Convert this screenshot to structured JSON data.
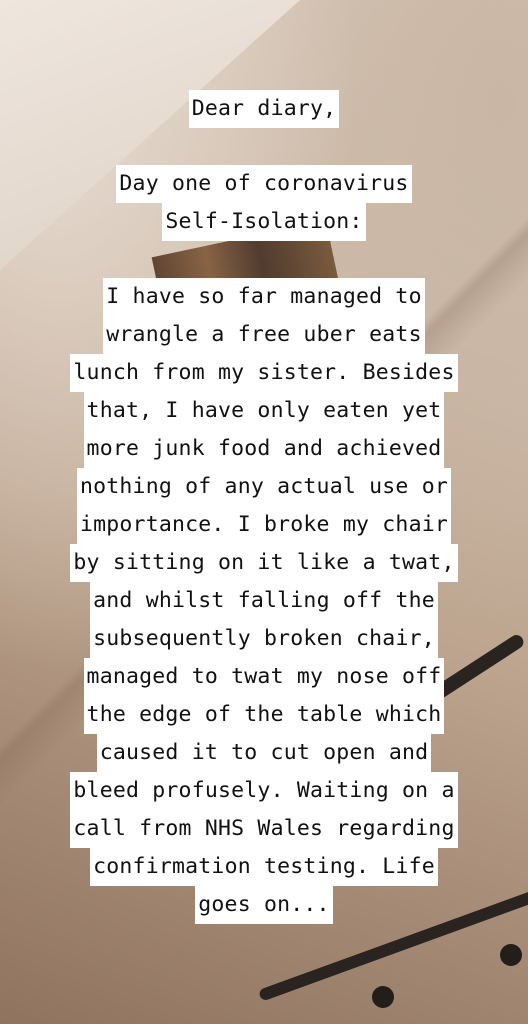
{
  "greeting": "Dear diary,",
  "heading_lines": [
    "Day one of coronavirus",
    "Self-Isolation:"
  ],
  "body_lines": [
    "I have so far managed to",
    "wrangle a free uber eats",
    "lunch from my sister. Besides",
    "that, I have only eaten yet",
    "more junk food and achieved",
    "nothing of any actual use or",
    "importance. I broke my chair",
    "by sitting on it like a twat,",
    "and whilst falling off the",
    "subsequently broken chair,",
    "managed to twat my nose off",
    "the edge of the table which",
    "caused it to cut open and",
    "bleed profusely. Waiting on a",
    "call from NHS Wales regarding",
    "confirmation testing. Life",
    "goes on..."
  ]
}
